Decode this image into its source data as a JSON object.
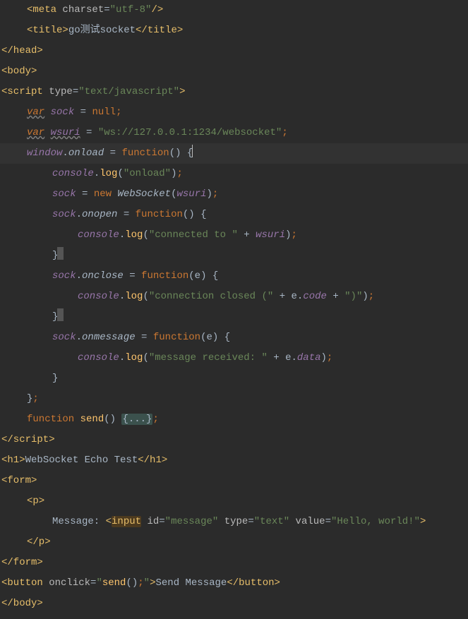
{
  "editor": {
    "language": "html-with-javascript",
    "current_line_index": 7,
    "highlighted_word": "input",
    "folded_region_label": "{...}",
    "lines": [
      {
        "indent": 4,
        "html": "<span class='tag'>&lt;meta </span><span class='attr'>charset</span><span class='eq'>=</span><span class='str'>\"utf-8\"</span><span class='tag'>/&gt;</span>"
      },
      {
        "indent": 4,
        "html": "<span class='tag'>&lt;title&gt;</span><span class='text'>go测试socket</span><span class='tag'>&lt;/title&gt;</span>"
      },
      {
        "indent": 0,
        "html": "<span class='tag'>&lt;/head&gt;</span>"
      },
      {
        "indent": 0,
        "html": "<span class='tag'>&lt;body&gt;</span>"
      },
      {
        "indent": 0,
        "html": "<span class='tag'>&lt;script </span><span class='attr'>type</span><span class='eq'>=</span><span class='str'>\"text/javascript\"</span><span class='tag'>&gt;</span>"
      },
      {
        "indent": 4,
        "html": "<span class='kw-i squiggle'>var</span> <span class='prop-i'>sock</span> <span class='op'>=</span> <span class='kw'>null</span><span class='semi'>;</span>"
      },
      {
        "indent": 4,
        "html": "<span class='kw-i squiggle'>var</span> <span class='prop-i squiggle'>wsuri</span> <span class='op'>=</span> <span class='str'>\"ws://127.0.0.1:1234/websocket\"</span><span class='semi'>;</span>"
      },
      {
        "indent": 4,
        "current": true,
        "html": "<span class='prop-i'>window</span><span class='op'>.</span><span class='def-i'>onload</span> <span class='op'>=</span> <span class='kw'>function</span><span class='op'>() {</span><span class='caret'></span>"
      },
      {
        "indent": 8,
        "html": "<span class='prop-i'>console</span><span class='op'>.</span><span class='fn'>log</span><span class='op'>(</span><span class='str'>\"onload\"</span><span class='op'>)</span><span class='semi'>;</span>"
      },
      {
        "indent": 8,
        "html": "<span class='prop-i'>sock</span> <span class='op'>=</span> <span class='kw'>new</span> <span class='def-i'>WebSocket</span><span class='op'>(</span><span class='prop-i'>wsuri</span><span class='op'>)</span><span class='semi'>;</span>"
      },
      {
        "indent": 8,
        "html": "<span class='prop-i'>sock</span><span class='op'>.</span><span class='def-i'>onopen</span> <span class='op'>=</span> <span class='kw'>function</span><span class='op'>() {</span>"
      },
      {
        "indent": 12,
        "html": "<span class='prop-i'>console</span><span class='op'>.</span><span class='fn'>log</span><span class='op'>(</span><span class='str'>\"connected to \"</span> <span class='op'>+</span> <span class='prop-i'>wsuri</span><span class='op'>)</span><span class='semi'>;</span>"
      },
      {
        "indent": 8,
        "html": "<span class='op'>}</span><span class='ws-mark'></span>"
      },
      {
        "indent": 8,
        "html": "<span class='prop-i'>sock</span><span class='op'>.</span><span class='def-i'>onclose</span> <span class='op'>=</span> <span class='kw'>function</span><span class='op'>(</span><span class='ident'>e</span><span class='op'>) {</span>"
      },
      {
        "indent": 12,
        "html": "<span class='prop-i'>console</span><span class='op'>.</span><span class='fn'>log</span><span class='op'>(</span><span class='str'>\"connection closed (\"</span> <span class='op'>+</span> <span class='ident'>e</span><span class='op'>.</span><span class='prop-i'>code</span> <span class='op'>+</span> <span class='str'>\")\"</span><span class='op'>)</span><span class='semi'>;</span>"
      },
      {
        "indent": 8,
        "html": "<span class='op'>}</span><span class='ws-mark'></span>"
      },
      {
        "indent": 8,
        "html": "<span class='prop-i'>sock</span><span class='op'>.</span><span class='def-i'>onmessage</span> <span class='op'>=</span> <span class='kw'>function</span><span class='op'>(</span><span class='ident'>e</span><span class='op'>) {</span>"
      },
      {
        "indent": 12,
        "html": "<span class='prop-i'>console</span><span class='op'>.</span><span class='fn'>log</span><span class='op'>(</span><span class='str'>\"message received: \"</span> <span class='op'>+</span> <span class='ident'>e</span><span class='op'>.</span><span class='prop-i'>data</span><span class='op'>)</span><span class='semi'>;</span>"
      },
      {
        "indent": 8,
        "html": "<span class='op'>}</span>"
      },
      {
        "indent": 4,
        "html": "<span class='op'>}</span><span class='semi'>;</span>"
      },
      {
        "indent": 4,
        "html": "<span class='kw'>function</span> <span class='fn'>send</span><span class='op'>() </span><span class='fold'>{...}</span><span class='semi'>;</span>"
      },
      {
        "indent": 0,
        "html": "<span class='tag'>&lt;/script&gt;</span>"
      },
      {
        "indent": 0,
        "html": "<span class='tag'>&lt;h1&gt;</span><span class='text'>WebSocket Echo Test</span><span class='tag'>&lt;/h1&gt;</span>"
      },
      {
        "indent": 0,
        "html": "<span class='tag'>&lt;form&gt;</span>"
      },
      {
        "indent": 4,
        "html": "<span class='tag'>&lt;p&gt;</span>"
      },
      {
        "indent": 8,
        "html": "<span class='text'>Message: </span><span class='tag'>&lt;</span><span class='hl-word tag'>input</span><span class='tag'> </span><span class='attr'>id</span><span class='eq'>=</span><span class='str'>\"message\"</span><span class='tag'> </span><span class='attr'>type</span><span class='eq'>=</span><span class='str'>\"text\"</span><span class='tag'> </span><span class='attr'>value</span><span class='eq'>=</span><span class='str'>\"Hello, world!\"</span><span class='tag'>&gt;</span>"
      },
      {
        "indent": 4,
        "html": "<span class='tag'>&lt;/p&gt;</span>"
      },
      {
        "indent": 0,
        "html": "<span class='tag'>&lt;/form&gt;</span>"
      },
      {
        "indent": 0,
        "html": "<span class='tag'>&lt;button </span><span class='attr'>onclick</span><span class='eq'>=</span><span class='str'>\"</span><span class='fn'>send</span><span class='op'>()</span><span class='semi'>;</span><span class='str'>\"</span><span class='tag'>&gt;</span><span class='text'>Send Message</span><span class='tag'>&lt;/button&gt;</span>"
      },
      {
        "indent": 0,
        "html": "<span class='tag'>&lt;/body&gt;</span>"
      }
    ]
  }
}
